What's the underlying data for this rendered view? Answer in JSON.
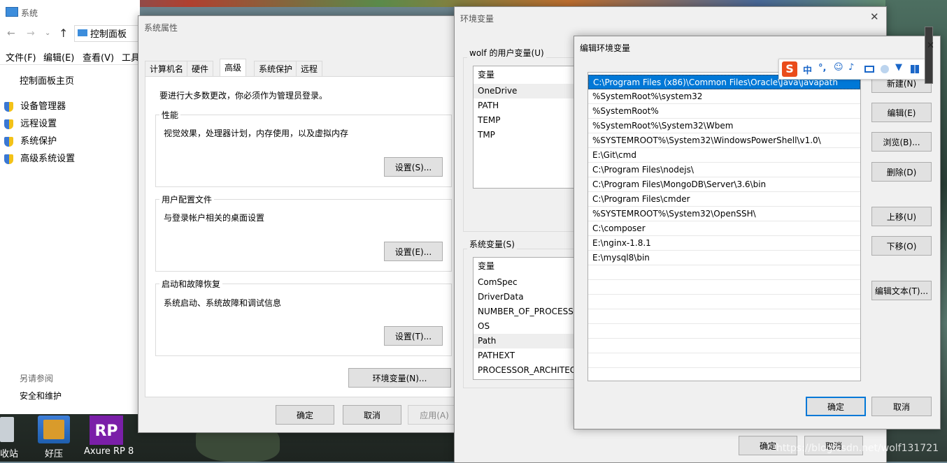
{
  "system_window": {
    "title": "系统",
    "breadcrumb": "控制面板",
    "menu": [
      "文件(F)",
      "编辑(E)",
      "查看(V)",
      "工具"
    ],
    "home_link": "控制面板主页",
    "side_links": [
      "设备管理器",
      "远程设置",
      "系统保护",
      "高级系统设置"
    ],
    "see_also_heading": "另请参阅",
    "see_also_link": "安全和维护"
  },
  "taskbar_icons": [
    {
      "label": "收站"
    },
    {
      "label": "好压"
    },
    {
      "label": "Axure RP 8",
      "glyph": "RP"
    }
  ],
  "sysprops": {
    "title": "系统属性",
    "tabs": [
      "计算机名",
      "硬件",
      "高级",
      "系统保护",
      "远程"
    ],
    "active_tab": "高级",
    "admin_note": "要进行大多数更改，你必须作为管理员登录。",
    "performance": {
      "label": "性能",
      "desc": "视觉效果，处理器计划，内存使用，以及虚拟内存",
      "button": "设置(S)..."
    },
    "profiles": {
      "label": "用户配置文件",
      "desc": "与登录帐户相关的桌面设置",
      "button": "设置(E)..."
    },
    "startup": {
      "label": "启动和故障恢复",
      "desc": "系统启动、系统故障和调试信息",
      "button": "设置(T)..."
    },
    "env_button": "环境变量(N)...",
    "ok": "确定",
    "cancel": "取消",
    "apply": "应用(A)"
  },
  "envvars": {
    "title": "环境变量",
    "user_group": "wolf 的用户变量(U)",
    "user_header": "变量",
    "user_vars": [
      "OneDrive",
      "PATH",
      "TEMP",
      "TMP"
    ],
    "sys_group": "系统变量(S)",
    "sys_header": "变量",
    "sys_vars": [
      "ComSpec",
      "DriverData",
      "NUMBER_OF_PROCESSO",
      "OS",
      "Path",
      "PATHEXT",
      "PROCESSOR_ARCHITECT"
    ],
    "ok": "确定",
    "cancel": "取消"
  },
  "edit_env": {
    "title": "编辑环境变量",
    "paths": [
      "C:\\Program Files (x86)\\Common Files\\Oracle\\Java\\javapath",
      "%SystemRoot%\\system32",
      "%SystemRoot%",
      "%SystemRoot%\\System32\\Wbem",
      "%SYSTEMROOT%\\System32\\WindowsPowerShell\\v1.0\\",
      "E:\\Git\\cmd",
      "C:\\Program Files\\nodejs\\",
      "C:\\Program Files\\MongoDB\\Server\\3.6\\bin",
      "C:\\Program Files\\cmder",
      "%SYSTEMROOT%\\System32\\OpenSSH\\",
      "C:\\composer",
      "E:\\nginx-1.8.1",
      "E:\\mysql8\\bin"
    ],
    "buttons": {
      "new": "新建(N)",
      "edit": "编辑(E)",
      "browse": "浏览(B)...",
      "delete": "删除(D)",
      "up": "上移(U)",
      "down": "下移(O)",
      "edit_text": "编辑文本(T)..."
    },
    "ok": "确定",
    "cancel": "取消"
  },
  "ime_toolbar": {
    "logo": "S",
    "mode": "中",
    "punct": "°,"
  },
  "watermark": "https://blog.csdn.net/wolf131721"
}
